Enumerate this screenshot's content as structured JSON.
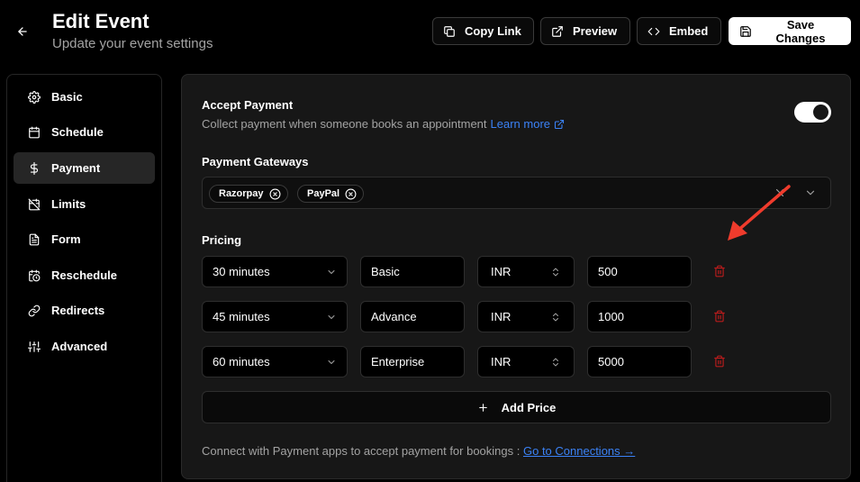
{
  "header": {
    "title": "Edit Event",
    "subtitle": "Update your event settings",
    "buttons": {
      "copy_link": "Copy Link",
      "preview": "Preview",
      "embed": "Embed",
      "save": "Save Changes"
    }
  },
  "sidebar": {
    "items": [
      {
        "label": "Basic",
        "icon": "gear-icon"
      },
      {
        "label": "Schedule",
        "icon": "calendar-icon"
      },
      {
        "label": "Payment",
        "icon": "dollar-icon",
        "active": true
      },
      {
        "label": "Limits",
        "icon": "calendar-off-icon"
      },
      {
        "label": "Form",
        "icon": "document-icon"
      },
      {
        "label": "Reschedule",
        "icon": "calendar-clock-icon"
      },
      {
        "label": "Redirects",
        "icon": "link-icon"
      },
      {
        "label": "Advanced",
        "icon": "sliders-icon"
      }
    ]
  },
  "payment": {
    "accept_title": "Accept Payment",
    "accept_desc": "Collect payment when someone books an appointment",
    "learn_more": "Learn more",
    "accept_enabled": true,
    "gateways_label": "Payment Gateways",
    "gateways": [
      "Razorpay",
      "PayPal"
    ],
    "pricing_label": "Pricing",
    "prices": [
      {
        "duration": "30 minutes",
        "name": "Basic",
        "currency": "INR",
        "amount": "500"
      },
      {
        "duration": "45 minutes",
        "name": "Advance",
        "currency": "INR",
        "amount": "1000"
      },
      {
        "duration": "60 minutes",
        "name": "Enterprise",
        "currency": "INR",
        "amount": "5000"
      }
    ],
    "add_price": "Add Price",
    "connect_text": "Connect with Payment apps to accept payment for bookings : ",
    "connect_link": "Go to Connections →"
  },
  "colors": {
    "background": "#000000",
    "panel": "#171717",
    "link": "#3b82f6",
    "delete": "#b91c1c",
    "annotation_arrow": "#ef3b2c"
  }
}
